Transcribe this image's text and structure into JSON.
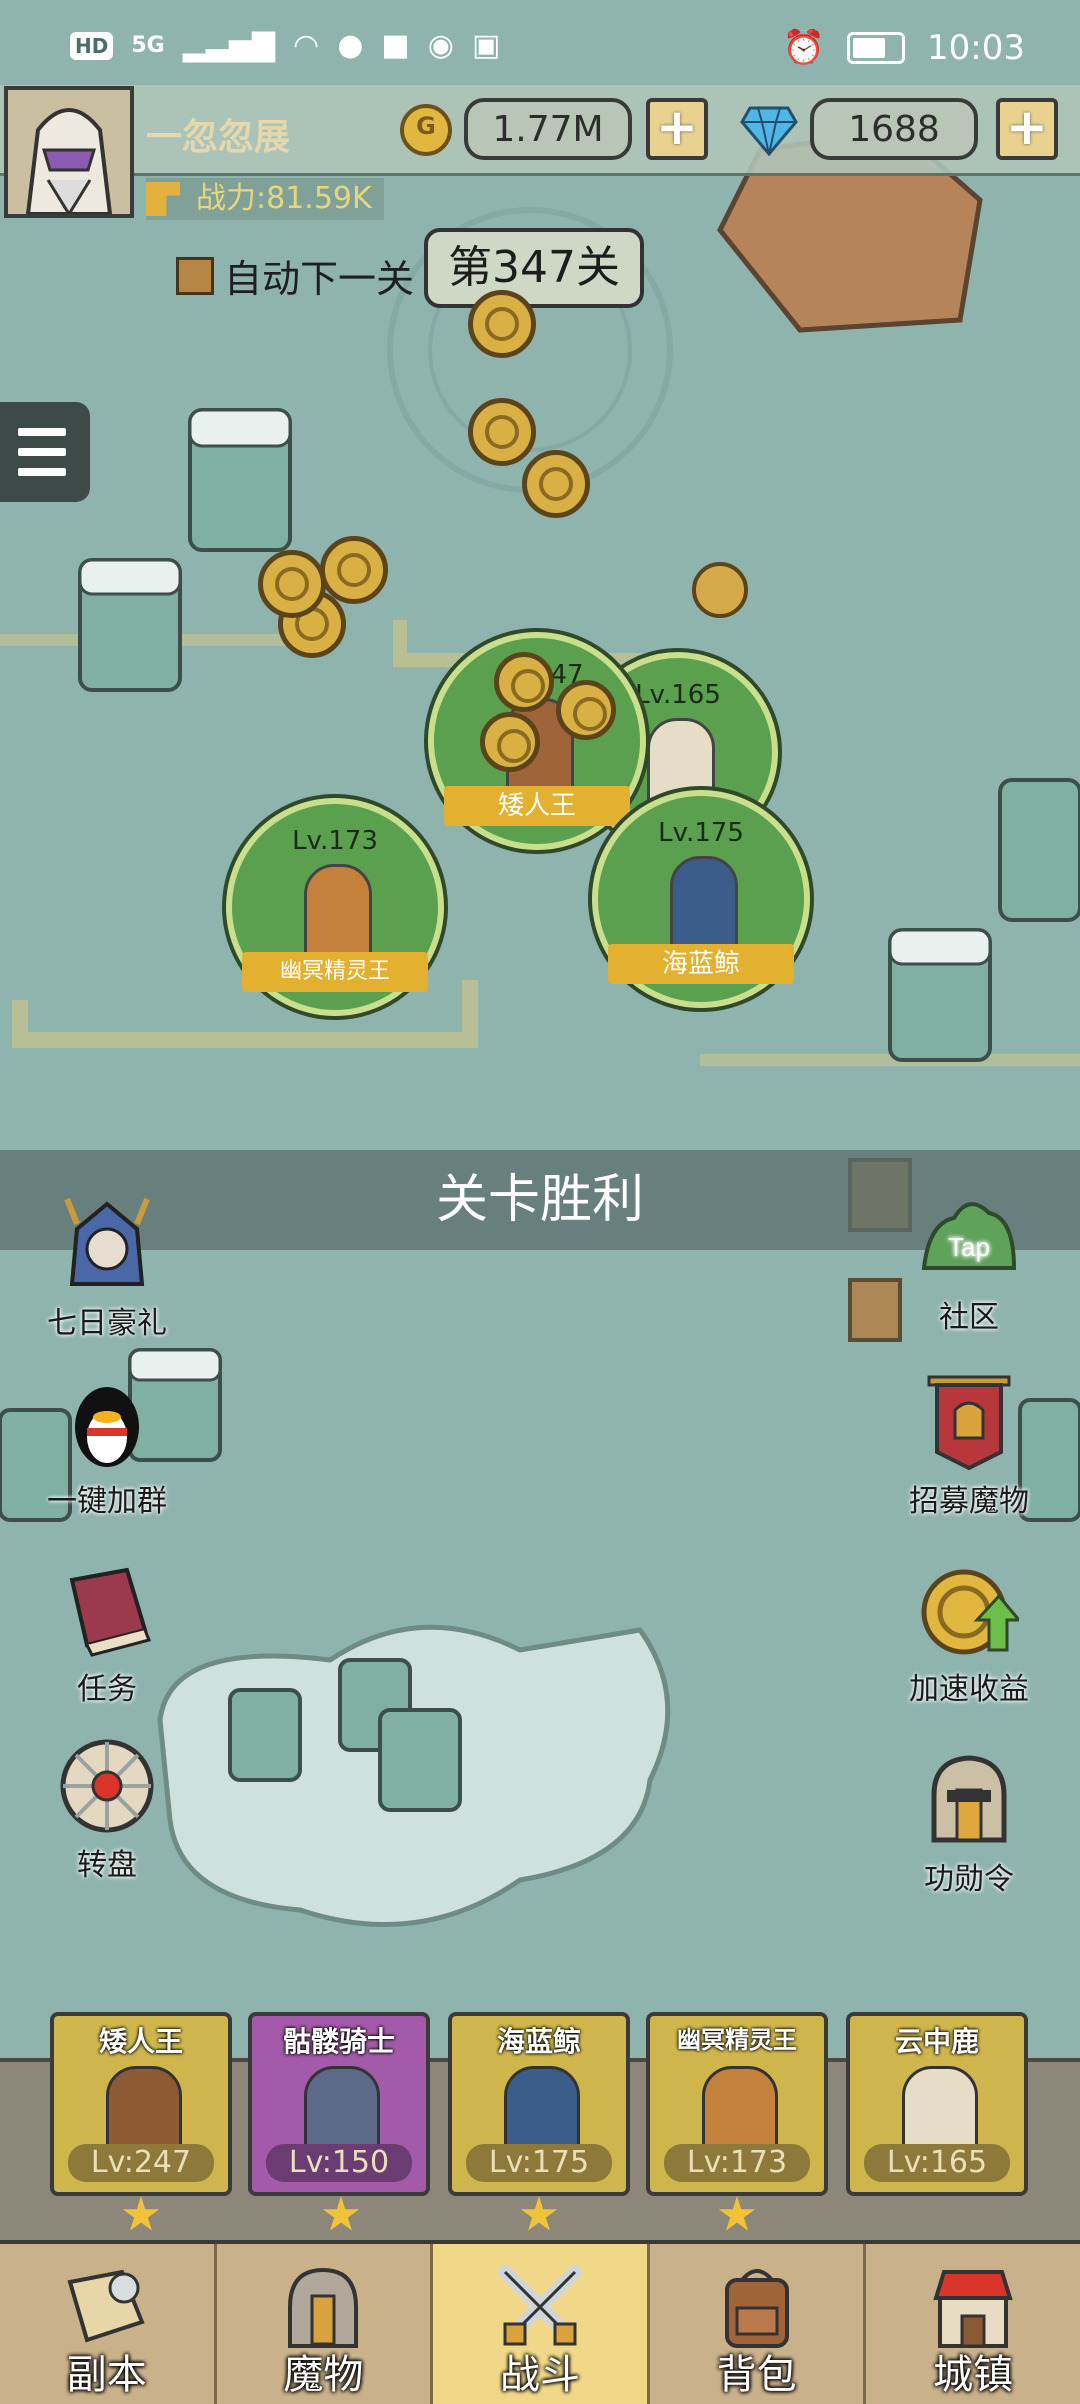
{
  "status_bar": {
    "hd": "HD",
    "network": "5G",
    "time": "10:03"
  },
  "player": {
    "name": "一忽忽展",
    "power": "战力:81.59K"
  },
  "currency": {
    "gold": "1.77M",
    "gems": "1688"
  },
  "stage": {
    "auto_next_label": "自动下一关",
    "auto_next_checked": false,
    "stage_label": "第347关"
  },
  "map_units": [
    {
      "level": "47",
      "name": "矮人王"
    },
    {
      "level": "Lv.165",
      "name": ""
    },
    {
      "level": "Lv.173",
      "name": "幽冥精灵王"
    },
    {
      "level": "Lv.175",
      "name": "海蓝鲸"
    }
  ],
  "banner": "关卡胜利",
  "left_buttons": [
    {
      "label": "七日豪礼",
      "icon": "armored-warrior-icon"
    },
    {
      "label": "一键加群",
      "icon": "penguin-icon"
    },
    {
      "label": "任务",
      "icon": "quest-book-icon"
    },
    {
      "label": "转盘",
      "icon": "roulette-wheel-icon"
    }
  ],
  "right_buttons": [
    {
      "label": "社区",
      "icon": "taptap-community-icon",
      "sub": "Tap"
    },
    {
      "label": "招募魔物",
      "icon": "recruit-banner-icon"
    },
    {
      "label": "加速收益",
      "icon": "speed-up-coin-icon"
    },
    {
      "label": "功勋令",
      "icon": "merit-helmet-icon"
    }
  ],
  "heroes": [
    {
      "name": "矮人王",
      "level": "Lv:247",
      "stars": 1
    },
    {
      "name": "骷髅骑士",
      "level": "Lv:150",
      "stars": 1
    },
    {
      "name": "海蓝鲸",
      "level": "Lv:175",
      "stars": 1
    },
    {
      "name": "幽冥精灵王",
      "level": "Lv:173",
      "stars": 1
    },
    {
      "name": "云中鹿",
      "level": "Lv:165",
      "stars": 0
    }
  ],
  "nav": [
    {
      "label": "副本",
      "icon": "map-scroll-icon"
    },
    {
      "label": "魔物",
      "icon": "monster-helmet-icon"
    },
    {
      "label": "战斗",
      "icon": "crossed-swords-icon",
      "active": true
    },
    {
      "label": "背包",
      "icon": "backpack-icon"
    },
    {
      "label": "城镇",
      "icon": "town-shop-icon"
    }
  ],
  "colors": {
    "map_bg": "#8fb4ae",
    "unit_green": "#5aa04f",
    "gold": "#e3b02f",
    "nav_active": "#f1d889"
  }
}
